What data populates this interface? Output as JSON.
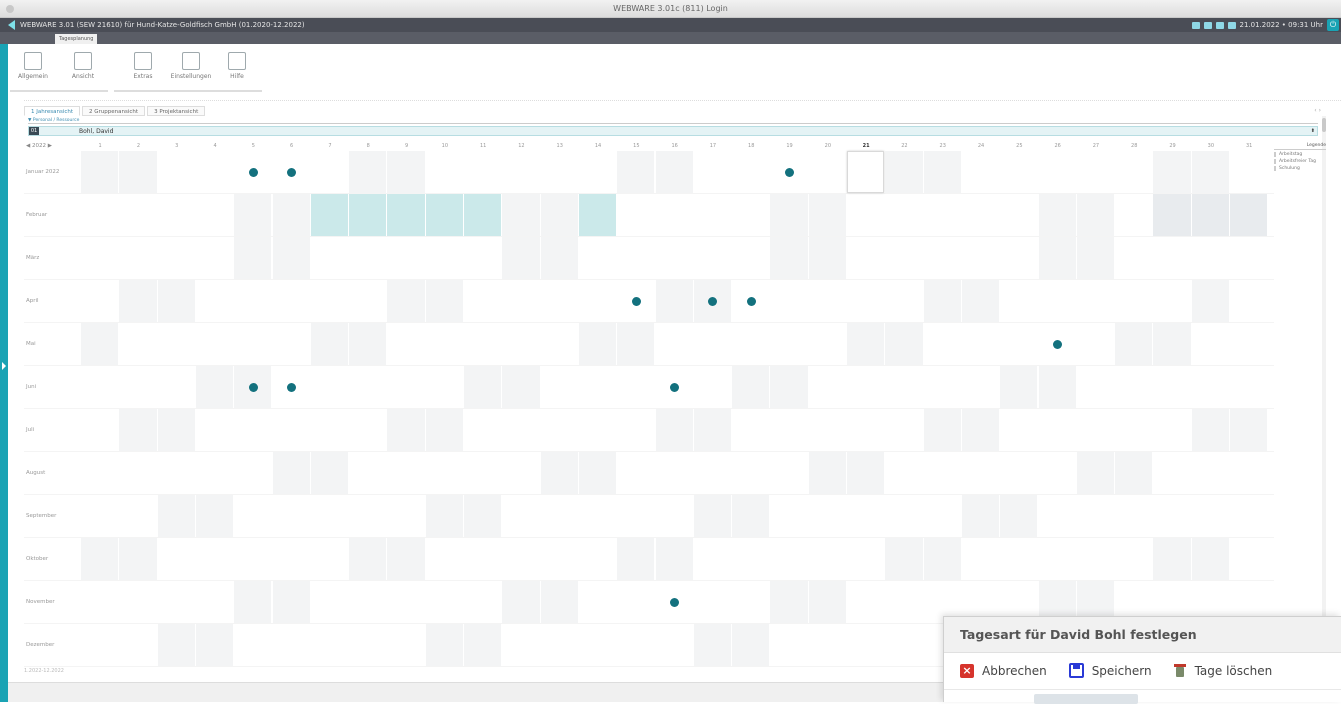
{
  "window": {
    "title": "WEBWARE 3.01c (811) Login"
  },
  "appbar": {
    "title": "WEBWARE 3.01 (SEW 21610) für Hund-Katze-Goldfisch GmbH (01.2020-12.2022)",
    "datetime": "21.01.2022 • 09:31 Uhr"
  },
  "tab": {
    "label": "Tagesplanung"
  },
  "ribbon": {
    "buttons": [
      {
        "label": "Allgemein",
        "icon": "arrow-icon"
      },
      {
        "label": "Ansicht",
        "icon": "view-icon"
      },
      {
        "label": "Extras",
        "icon": "extras-icon"
      },
      {
        "label": "Einstellungen",
        "icon": "settings-icon"
      },
      {
        "label": "Hilfe",
        "icon": "help-icon"
      }
    ]
  },
  "views": {
    "tabs": [
      "1 Jahresansicht",
      "2 Gruppenansicht",
      "3 Projektansicht"
    ],
    "active": 0
  },
  "person": {
    "section_label": "Personal / Ressource",
    "id": "01",
    "name": "Bohl, David"
  },
  "calendar": {
    "year": "2022",
    "days": [
      "1",
      "2",
      "3",
      "4",
      "5",
      "6",
      "7",
      "8",
      "9",
      "10",
      "11",
      "12",
      "13",
      "14",
      "15",
      "16",
      "17",
      "18",
      "19",
      "20",
      "21",
      "22",
      "23",
      "24",
      "25",
      "26",
      "27",
      "28",
      "29",
      "30",
      "31"
    ],
    "today": {
      "month": 0,
      "day": 21
    },
    "months": [
      {
        "label": "Januar 2022",
        "we": [
          1,
          2,
          8,
          9,
          15,
          16,
          22,
          23,
          29,
          30
        ],
        "dots": [
          5,
          6,
          19
        ]
      },
      {
        "label": "Februar",
        "we": [
          5,
          6,
          12,
          13,
          19,
          20,
          26,
          27
        ],
        "vac": [
          7,
          8,
          9,
          10,
          11,
          14
        ],
        "blocked": [
          29,
          30,
          31
        ],
        "dots": []
      },
      {
        "label": "März",
        "we": [
          5,
          6,
          12,
          13,
          19,
          20,
          26,
          27
        ],
        "dots": []
      },
      {
        "label": "April",
        "we": [
          2,
          3,
          9,
          10,
          16,
          17,
          23,
          24,
          30
        ],
        "dots": [
          15,
          17,
          18
        ]
      },
      {
        "label": "Mai",
        "we": [
          1,
          7,
          8,
          14,
          15,
          21,
          22,
          28,
          29
        ],
        "dots": [
          26
        ]
      },
      {
        "label": "Juni",
        "we": [
          4,
          5,
          11,
          12,
          18,
          19,
          25,
          26
        ],
        "dots": [
          5,
          6,
          16
        ]
      },
      {
        "label": "Juli",
        "we": [
          2,
          3,
          9,
          10,
          16,
          17,
          23,
          24,
          30,
          31
        ],
        "dots": []
      },
      {
        "label": "August",
        "we": [
          6,
          7,
          13,
          14,
          20,
          21,
          27,
          28
        ],
        "dots": []
      },
      {
        "label": "September",
        "we": [
          3,
          4,
          10,
          11,
          17,
          18,
          24,
          25
        ],
        "dots": []
      },
      {
        "label": "Oktober",
        "we": [
          1,
          2,
          8,
          9,
          15,
          16,
          22,
          23,
          29,
          30
        ],
        "dots": []
      },
      {
        "label": "November",
        "we": [
          5,
          6,
          12,
          13,
          19,
          20,
          26,
          27
        ],
        "dots": [
          16
        ]
      },
      {
        "label": "Dezember",
        "we": [
          3,
          4,
          10,
          11,
          17,
          18,
          24,
          25,
          31
        ],
        "dots": []
      }
    ]
  },
  "legend": {
    "title": "Legende",
    "items": [
      "Arbeitstag",
      "Arbeitsfreier Tag",
      "Schulung"
    ]
  },
  "footer": {
    "range": "1.2022-12.2022"
  },
  "dialog": {
    "title": "Tagesart für David Bohl festlegen",
    "cancel": "Abbrechen",
    "save": "Speichern",
    "delete": "Tage löschen"
  },
  "colors": {
    "accent": "#1aa3b4",
    "dot": "#13717e",
    "vacation": "#cbe9ea",
    "weekend": "#f3f4f5"
  }
}
